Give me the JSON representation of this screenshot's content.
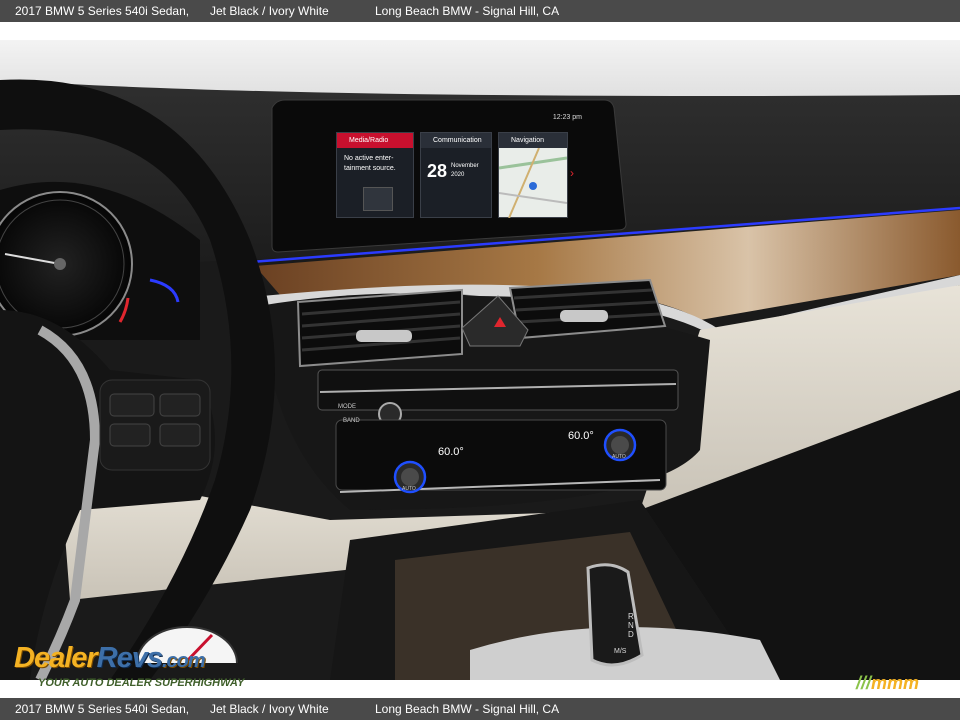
{
  "header": {
    "vehicle": "2017 BMW 5 Series 540i Sedan,",
    "color": "Jet Black / Ivory White",
    "dealer": "Long Beach BMW - Signal Hill, CA"
  },
  "footer": {
    "vehicle": "2017 BMW 5 Series 540i Sedan,",
    "color": "Jet Black / Ivory White",
    "dealer": "Long Beach BMW - Signal Hill, CA"
  },
  "idrive": {
    "status_time": "12:23 pm",
    "tiles": [
      {
        "title": "Media/Radio",
        "line1": "No active enter-",
        "line2": "tainment source."
      },
      {
        "title": "Communication",
        "day": "28",
        "month": "November",
        "year": "2020"
      },
      {
        "title": "Navigation"
      }
    ]
  },
  "climate": {
    "left_temp": "60.0°",
    "right_temp": "60.0°",
    "mode_label": "MODE",
    "band_label": "BAND",
    "auto_label": "AUTO"
  },
  "gear_shift": {
    "letters": "R N D",
    "mode": "M/S"
  },
  "watermark": {
    "dealer": "Dealer",
    "revs": "Revs",
    "com": ".com",
    "tagline": "YOUR AUTO DEALER SUPERHIGHWAY",
    "brand": "mmm"
  },
  "colors": {
    "bar": "#4a4a4a",
    "media_accent": "#c8102e",
    "ambient_light": "#2b3bff",
    "wood": "#8a5a2e"
  }
}
